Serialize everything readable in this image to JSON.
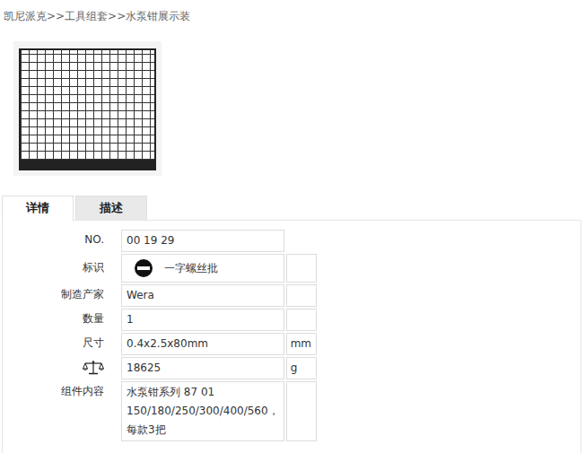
{
  "breadcrumb": {
    "items": [
      "凯尼派克",
      "工具组套",
      "水泵钳展示装"
    ],
    "separator": ">>"
  },
  "tabs": [
    {
      "label": "详情",
      "selected": true
    },
    {
      "label": "描述",
      "selected": false
    }
  ],
  "specs": [
    {
      "kind": "text",
      "label": "NO.",
      "value": "00 19 29",
      "unit": "",
      "unit_cell": false
    },
    {
      "kind": "icon-value",
      "label": "标识",
      "value": "一字螺丝批",
      "unit": "",
      "unit_cell": true
    },
    {
      "kind": "text",
      "label": "制造产家",
      "value": "Wera",
      "unit": "",
      "unit_cell": true
    },
    {
      "kind": "text",
      "label": "数量",
      "value": "1",
      "unit": "",
      "unit_cell": true
    },
    {
      "kind": "text",
      "label": "尺寸",
      "value": "0.4x2.5x80mm",
      "unit": "mm",
      "unit_cell": true
    },
    {
      "kind": "icon-label",
      "label": "",
      "value": "18625",
      "unit": "g",
      "unit_cell": true
    },
    {
      "kind": "text",
      "label": "组件内容",
      "value": "水泵钳系列 87 01 150/180/250/300/400/560，每款3把",
      "unit": "",
      "unit_cell": true
    }
  ]
}
